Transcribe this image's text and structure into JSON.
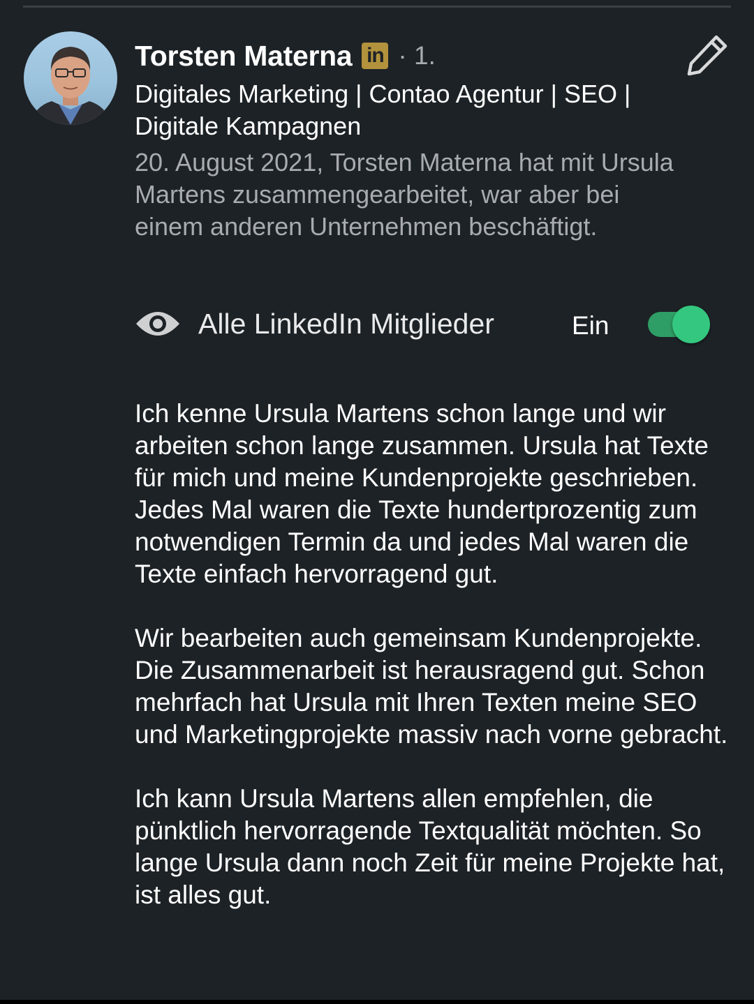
{
  "recommendation": {
    "author": {
      "name": "Torsten Materna",
      "badge_icon": "linkedin-premium-icon",
      "badge_text": "in",
      "badge_color": "#b2923c",
      "degree": "· 1.",
      "headline": "Digitales Marketing | Contao Agentur | SEO | Digitale Kampagnen"
    },
    "edit_icon": "pencil-icon",
    "context": "20. August 2021, Torsten Materna hat mit Ursula Martens zusammengearbeitet, war aber bei einem anderen Unternehmen beschäftigt.",
    "visibility": {
      "icon": "eye-icon",
      "label": "Alle LinkedIn Mitglieder",
      "state_label": "Ein",
      "toggle_on": true,
      "toggle_color": "#34c77f"
    },
    "paragraphs": [
      "Ich kenne Ursula Martens schon lange und wir arbeiten schon lange zusammen. Ursula hat Texte für mich und meine Kundenprojekte geschrieben. Jedes Mal waren die Texte hundertprozentig zum notwendigen Termin da und jedes Mal waren die Texte einfach hervorragend gut.",
      "Wir bearbeiten auch gemeinsam Kundenprojekte. Die Zusammenarbeit ist herausragend gut. Schon mehrfach hat Ursula mit Ihren Texten meine SEO und Marketingprojekte massiv nach vorne gebracht.",
      "Ich kann Ursula Martens allen empfehlen, die pünktlich hervorragende Textqualität möchten. So lange Ursula dann noch Zeit für meine Projekte hat, ist alles gut."
    ]
  },
  "theme": {
    "background": "#1d2226",
    "text_primary": "#ffffff",
    "text_secondary": "#a8acb0"
  }
}
